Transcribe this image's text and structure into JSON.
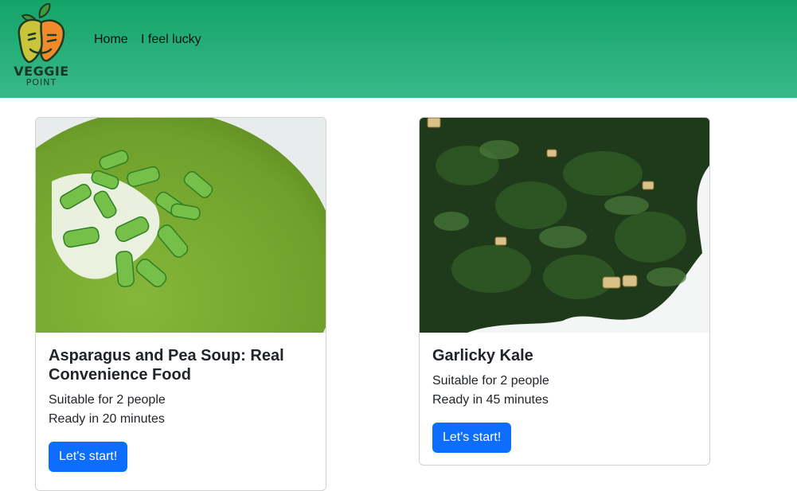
{
  "brand": {
    "name": "VEGGIE",
    "subtitle": "POINT"
  },
  "nav": {
    "items": [
      {
        "label": "Home"
      },
      {
        "label": "I feel lucky"
      }
    ]
  },
  "recipes": [
    {
      "title": "Asparagus and Pea Soup: Real Convenience Food",
      "servings": "Suitable for 2 people",
      "ready": "Ready in 20 minutes",
      "button": "Let's start!"
    },
    {
      "title": "Garlicky Kale",
      "servings": "Suitable for 2 people",
      "ready": "Ready in 45 minutes",
      "button": "Let's start!"
    }
  ],
  "colors": {
    "navbar": "#14a468",
    "button": "#0d6efd"
  }
}
